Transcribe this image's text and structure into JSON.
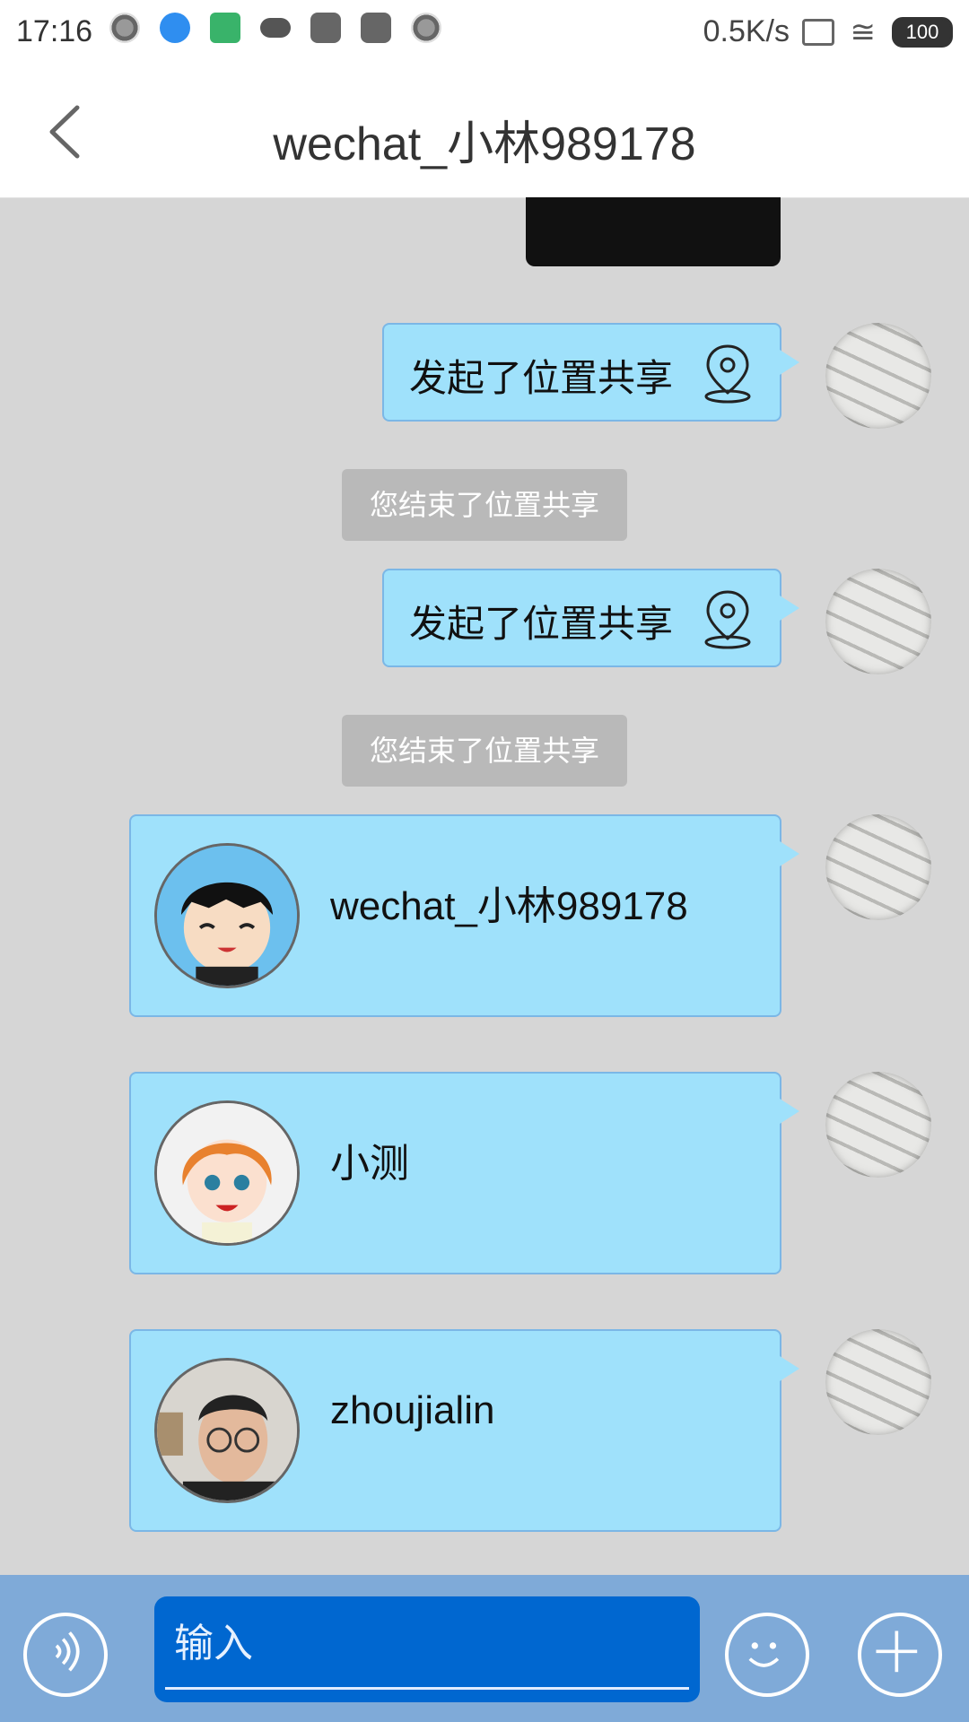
{
  "status_bar": {
    "time": "17:16",
    "speed": "0.5K/s",
    "battery": "100"
  },
  "header": {
    "title": "wechat_小林989178",
    "back_icon": "chevron-left-icon"
  },
  "messages": {
    "share1": "发起了位置共享",
    "sys1": "您结束了位置共享",
    "share2": "发起了位置共享",
    "sys2": "您结束了位置共享",
    "cards": [
      {
        "name": "wechat_小林989178",
        "avatar_icon": "cartoon-boy-avatar"
      },
      {
        "name": "小测",
        "avatar_icon": "cartoon-girl-avatar"
      },
      {
        "name": "zhoujialin",
        "avatar_icon": "photo-avatar"
      }
    ]
  },
  "composer": {
    "placeholder": "输入",
    "voice_icon": "voice-icon",
    "emoji_icon": "emoji-icon",
    "plus_icon": "plus-icon"
  },
  "colors": {
    "bubble": "#9fe1fb",
    "bubble_border": "#7bb7e6",
    "chat_bg": "#d6d6d6",
    "input_bg": "#0067d0",
    "bottom_bar": "#7faad8",
    "system_badge": "#b9b9b9"
  }
}
